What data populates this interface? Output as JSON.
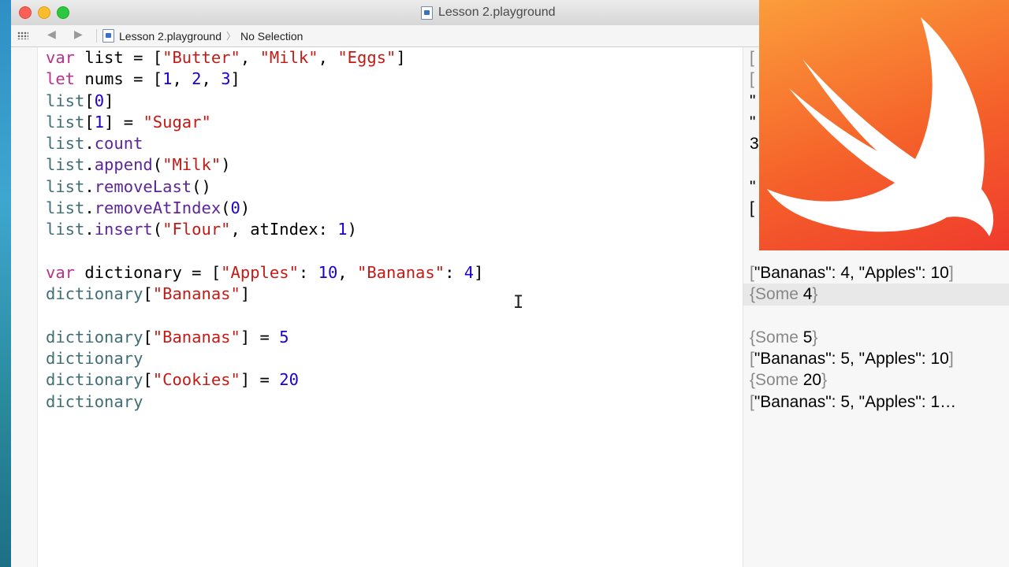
{
  "window": {
    "title": "Lesson 2.playground"
  },
  "jumpbar": {
    "file": "Lesson 2.playground",
    "selection": "No Selection"
  },
  "code": [
    [
      {
        "t": "var",
        "c": "kw"
      },
      {
        "t": " list = [",
        "c": "p"
      },
      {
        "t": "\"Butter\"",
        "c": "str"
      },
      {
        "t": ", ",
        "c": "p"
      },
      {
        "t": "\"Milk\"",
        "c": "str"
      },
      {
        "t": ", ",
        "c": "p"
      },
      {
        "t": "\"Eggs\"",
        "c": "str"
      },
      {
        "t": "]",
        "c": "p"
      }
    ],
    [
      {
        "t": "let",
        "c": "kw"
      },
      {
        "t": " nums = [",
        "c": "p"
      },
      {
        "t": "1",
        "c": "num"
      },
      {
        "t": ", ",
        "c": "p"
      },
      {
        "t": "2",
        "c": "num"
      },
      {
        "t": ", ",
        "c": "p"
      },
      {
        "t": "3",
        "c": "num"
      },
      {
        "t": "]",
        "c": "p"
      }
    ],
    [
      {
        "t": "list",
        "c": "id"
      },
      {
        "t": "[",
        "c": "p"
      },
      {
        "t": "0",
        "c": "num"
      },
      {
        "t": "]",
        "c": "p"
      }
    ],
    [
      {
        "t": "list",
        "c": "id"
      },
      {
        "t": "[",
        "c": "p"
      },
      {
        "t": "1",
        "c": "num"
      },
      {
        "t": "] = ",
        "c": "p"
      },
      {
        "t": "\"Sugar\"",
        "c": "str"
      }
    ],
    [
      {
        "t": "list",
        "c": "id"
      },
      {
        "t": ".",
        "c": "p"
      },
      {
        "t": "count",
        "c": "mem"
      }
    ],
    [
      {
        "t": "list",
        "c": "id"
      },
      {
        "t": ".",
        "c": "p"
      },
      {
        "t": "append",
        "c": "mem"
      },
      {
        "t": "(",
        "c": "p"
      },
      {
        "t": "\"Milk\"",
        "c": "str"
      },
      {
        "t": ")",
        "c": "p"
      }
    ],
    [
      {
        "t": "list",
        "c": "id"
      },
      {
        "t": ".",
        "c": "p"
      },
      {
        "t": "removeLast",
        "c": "mem"
      },
      {
        "t": "()",
        "c": "p"
      }
    ],
    [
      {
        "t": "list",
        "c": "id"
      },
      {
        "t": ".",
        "c": "p"
      },
      {
        "t": "removeAtIndex",
        "c": "mem"
      },
      {
        "t": "(",
        "c": "p"
      },
      {
        "t": "0",
        "c": "num"
      },
      {
        "t": ")",
        "c": "p"
      }
    ],
    [
      {
        "t": "list",
        "c": "id"
      },
      {
        "t": ".",
        "c": "p"
      },
      {
        "t": "insert",
        "c": "mem"
      },
      {
        "t": "(",
        "c": "p"
      },
      {
        "t": "\"Flour\"",
        "c": "str"
      },
      {
        "t": ", atIndex: ",
        "c": "p"
      },
      {
        "t": "1",
        "c": "num"
      },
      {
        "t": ")",
        "c": "p"
      }
    ],
    [],
    [
      {
        "t": "var",
        "c": "kw"
      },
      {
        "t": " dictionary = [",
        "c": "p"
      },
      {
        "t": "\"Apples\"",
        "c": "str"
      },
      {
        "t": ": ",
        "c": "p"
      },
      {
        "t": "10",
        "c": "num"
      },
      {
        "t": ", ",
        "c": "p"
      },
      {
        "t": "\"Bananas\"",
        "c": "str"
      },
      {
        "t": ": ",
        "c": "p"
      },
      {
        "t": "4",
        "c": "num"
      },
      {
        "t": "]",
        "c": "p"
      }
    ],
    [
      {
        "t": "dictionary",
        "c": "id"
      },
      {
        "t": "[",
        "c": "p"
      },
      {
        "t": "\"Bananas\"",
        "c": "str"
      },
      {
        "t": "]",
        "c": "p"
      }
    ],
    [],
    [
      {
        "t": "dictionary",
        "c": "id"
      },
      {
        "t": "[",
        "c": "p"
      },
      {
        "t": "\"Bananas\"",
        "c": "str"
      },
      {
        "t": "] = ",
        "c": "p"
      },
      {
        "t": "5",
        "c": "num"
      }
    ],
    [
      {
        "t": "dictionary",
        "c": "id"
      }
    ],
    [
      {
        "t": "dictionary",
        "c": "id"
      },
      {
        "t": "[",
        "c": "p"
      },
      {
        "t": "\"Cookies\"",
        "c": "str"
      },
      {
        "t": "] = ",
        "c": "p"
      },
      {
        "t": "20",
        "c": "num"
      }
    ],
    [
      {
        "t": "dictionary",
        "c": "id"
      }
    ]
  ],
  "results": [
    {
      "text": "[",
      "gray": true
    },
    {
      "text": "[",
      "gray": true
    },
    {
      "text": "\"",
      "gray": false
    },
    {
      "text": "\"",
      "gray": false
    },
    {
      "text": "3",
      "gray": false
    },
    {
      "text": "",
      "gray": false
    },
    {
      "text": "\"",
      "gray": false
    },
    {
      "text": "[",
      "gray": false
    },
    {
      "text": "",
      "gray": false
    },
    {
      "text": "",
      "gray": false
    },
    {
      "parts": [
        {
          "t": "[",
          "g": true
        },
        {
          "t": "\"Bananas\": 4, \"Apples\": 10",
          "g": false
        },
        {
          "t": "]",
          "g": true
        }
      ]
    },
    {
      "parts": [
        {
          "t": "{Some ",
          "g": true
        },
        {
          "t": "4",
          "g": false
        },
        {
          "t": "}",
          "g": true
        }
      ],
      "hl": true
    },
    {
      "text": "",
      "gray": false
    },
    {
      "parts": [
        {
          "t": "{Some ",
          "g": true
        },
        {
          "t": "5",
          "g": false
        },
        {
          "t": "}",
          "g": true
        }
      ]
    },
    {
      "parts": [
        {
          "t": "[",
          "g": true
        },
        {
          "t": "\"Bananas\": 5, \"Apples\": 10",
          "g": false
        },
        {
          "t": "]",
          "g": true
        }
      ]
    },
    {
      "parts": [
        {
          "t": "{Some ",
          "g": true
        },
        {
          "t": "20",
          "g": false
        },
        {
          "t": "}",
          "g": true
        }
      ]
    },
    {
      "parts": [
        {
          "t": "[",
          "g": true
        },
        {
          "t": "\"Bananas\": 5, \"Apples\": 1…",
          "g": false
        }
      ]
    }
  ],
  "colors": {
    "keyword": "#b8318b",
    "string": "#c41a16",
    "number": "#1c00cf",
    "identifier": "#3f6e74",
    "member": "#5c2699"
  },
  "icons": {
    "logo": "swift-logo",
    "cursor": "i-beam-cursor"
  }
}
